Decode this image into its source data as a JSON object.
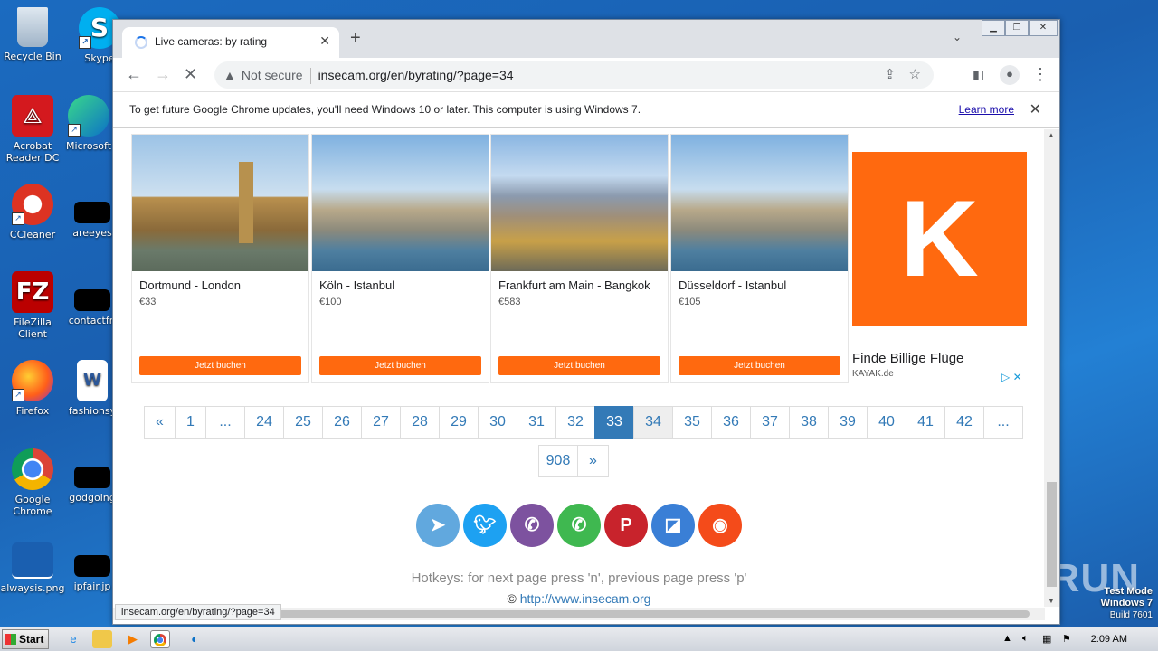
{
  "desktop": {
    "icons": [
      {
        "label": "Recycle Bin"
      },
      {
        "label": "Skype"
      },
      {
        "label": "Acrobat Reader DC"
      },
      {
        "label": "Microsoft"
      },
      {
        "label": "CCleaner"
      },
      {
        "label": "areeyes"
      },
      {
        "label": "FileZilla Client"
      },
      {
        "label": "contactfri"
      },
      {
        "label": "Firefox"
      },
      {
        "label": "fashionsy"
      },
      {
        "label": "Google Chrome"
      },
      {
        "label": "godgoing"
      },
      {
        "label": "alwaysis.png"
      },
      {
        "label": "ipfair.jp"
      }
    ],
    "watermark": "ANY RUN",
    "test_mode": {
      "line1": "Test Mode",
      "line2": "Windows 7",
      "line3": "Build 7601"
    }
  },
  "browser": {
    "tab_title": "Live cameras: by rating",
    "url_security": "Not secure",
    "url": "insecam.org/en/byrating/?page=34",
    "infobar_text": "To get future Google Chrome updates, you'll need Windows 10 or later. This computer is using Windows 7.",
    "infobar_link": "Learn more",
    "status_url": "insecam.org/en/byrating/?page=34"
  },
  "ads": {
    "cards": [
      {
        "title": "Dortmund - London",
        "price": "€33",
        "button": "Jetzt buchen"
      },
      {
        "title": "Köln - Istanbul",
        "price": "€100",
        "button": "Jetzt buchen"
      },
      {
        "title": "Frankfurt am Main - Bangkok",
        "price": "€583",
        "button": "Jetzt buchen"
      },
      {
        "title": "Düsseldorf - Istanbul",
        "price": "€105",
        "button": "Jetzt buchen"
      }
    ],
    "kayak_letter": "K",
    "kayak_title": "Finde Billige Flüge",
    "kayak_domain": "KAYAK.de"
  },
  "pagination": {
    "row1": [
      "«",
      "1",
      "...",
      "24",
      "25",
      "26",
      "27",
      "28",
      "29",
      "30",
      "31",
      "32",
      "33",
      "34",
      "35",
      "36",
      "37",
      "38",
      "39",
      "40",
      "41",
      "42",
      "..."
    ],
    "row2": [
      "908",
      "»"
    ],
    "active": "33"
  },
  "footer": {
    "hotkeys": "Hotkeys: for next page press 'n', previous page press 'p'",
    "copyright_symbol": "©",
    "copyright_link": "http://www.insecam.org"
  },
  "taskbar": {
    "start_label": "Start",
    "clock": "2:09 AM"
  },
  "colors": {
    "accent": "#337ab7",
    "ad_orange": "#ff690f"
  }
}
